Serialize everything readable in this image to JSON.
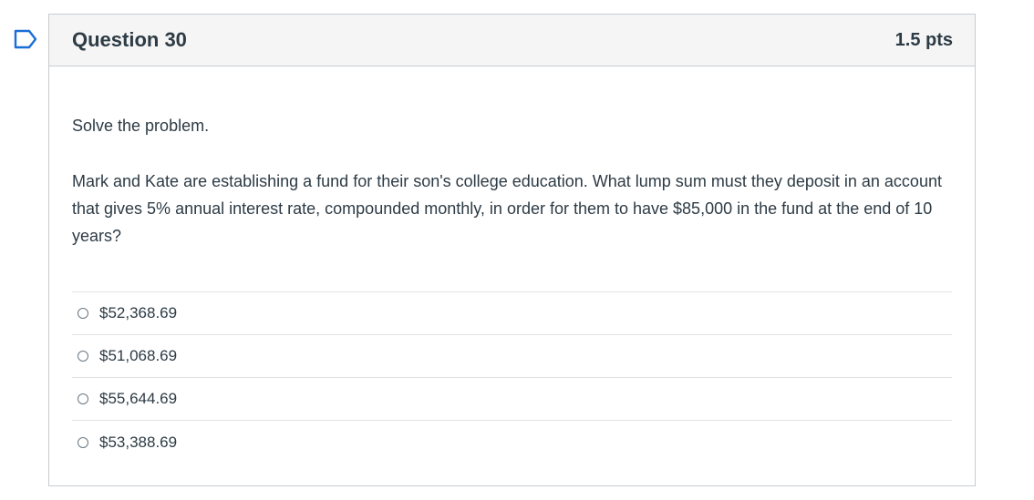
{
  "question": {
    "title": "Question 30",
    "points": "1.5 pts",
    "intro": "Solve the problem.",
    "text": "Mark and Kate are establishing a fund for their son's college education. What lump sum must they deposit in an account that gives 5% annual interest rate, compounded monthly, in order for them to have $85,000 in the fund at the end of 10 years?",
    "answers": [
      {
        "label": "$52,368.69"
      },
      {
        "label": "$51,068.69"
      },
      {
        "label": "$55,644.69"
      },
      {
        "label": "$53,388.69"
      }
    ]
  },
  "colors": {
    "flag": "#1a6fd6",
    "header_bg": "#f5f5f5",
    "border": "#c7cdd1",
    "text": "#2d3b45"
  },
  "icons": {
    "flag": "flag-icon",
    "radio": "radio-unchecked-icon"
  }
}
